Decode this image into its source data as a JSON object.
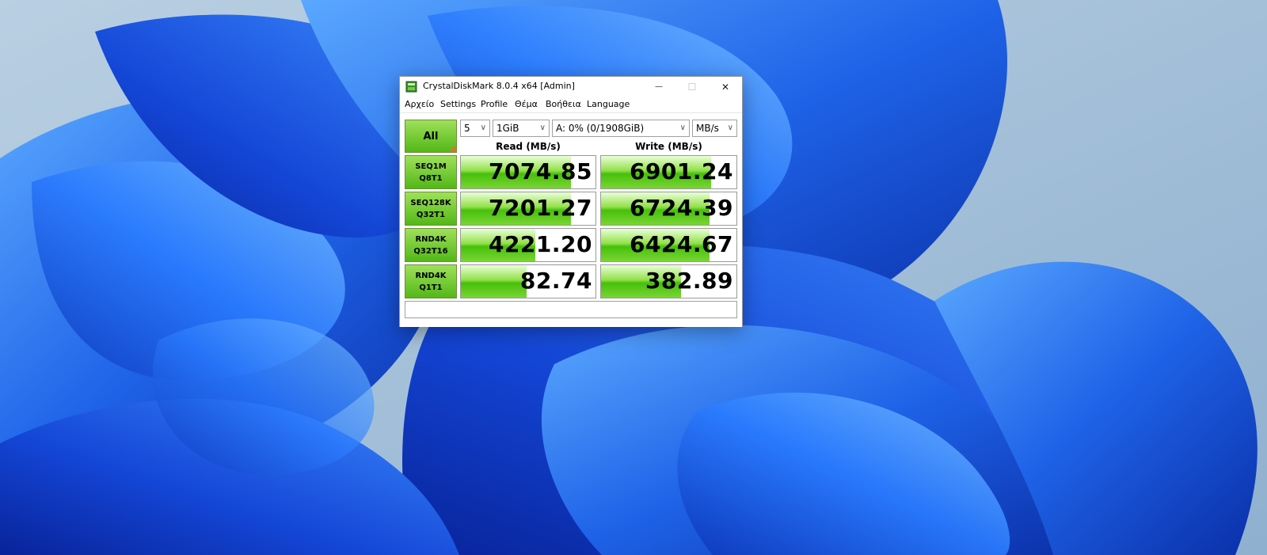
{
  "window": {
    "title": "CrystalDiskMark 8.0.4 x64 [Admin]",
    "minimize_glyph": "—",
    "maximize_glyph": "☐",
    "close_glyph": "✕"
  },
  "menu": {
    "items": [
      "Αρχείο",
      "Settings",
      "Profile",
      "Θέμα",
      "Βοήθεια",
      "Language"
    ]
  },
  "controls": {
    "all_label": "All",
    "count_value": "5",
    "size_value": "1GiB",
    "drive_value": "A: 0% (0/1908GiB)",
    "unit_value": "MB/s"
  },
  "headers": {
    "read": "Read (MB/s)",
    "write": "Write (MB/s)"
  },
  "tests": [
    {
      "line1": "SEQ1M",
      "line2": "Q8T1",
      "read": "7074.85",
      "write": "6901.24",
      "read_fill": 0.82,
      "write_fill": 0.81
    },
    {
      "line1": "SEQ128K",
      "line2": "Q32T1",
      "read": "7201.27",
      "write": "6724.39",
      "read_fill": 0.82,
      "write_fill": 0.8
    },
    {
      "line1": "RND4K",
      "line2": "Q32T16",
      "read": "4221.20",
      "write": "6424.67",
      "read_fill": 0.55,
      "write_fill": 0.8
    },
    {
      "line1": "RND4K",
      "line2": "Q1T1",
      "read": "82.74",
      "write": "382.89",
      "read_fill": 0.49,
      "write_fill": 0.59
    }
  ],
  "colors": {
    "accent_green": "#52b817",
    "corner_orange": "#e0702c",
    "wallpaper_blue": "#1f5fe0"
  },
  "status": {
    "text": ""
  }
}
